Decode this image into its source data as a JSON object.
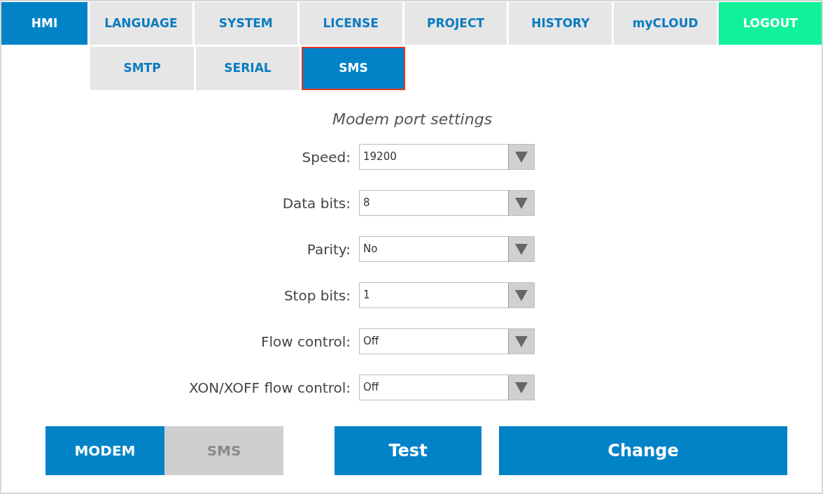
{
  "tabs": [
    {
      "label": "HMI",
      "selected": true,
      "kind": "normal"
    },
    {
      "label": "LANGUAGE",
      "selected": false,
      "kind": "normal"
    },
    {
      "label": "SYSTEM",
      "selected": false,
      "kind": "normal"
    },
    {
      "label": "LICENSE",
      "selected": false,
      "kind": "normal"
    },
    {
      "label": "PROJECT",
      "selected": false,
      "kind": "normal"
    },
    {
      "label": "HISTORY",
      "selected": false,
      "kind": "normal"
    },
    {
      "label": "myCLOUD",
      "selected": false,
      "kind": "normal"
    },
    {
      "label": "LOGOUT",
      "selected": false,
      "kind": "logout"
    }
  ],
  "subtabs": [
    {
      "label": "SMTP",
      "selected": false
    },
    {
      "label": "SERIAL",
      "selected": false
    },
    {
      "label": "SMS",
      "selected": true
    }
  ],
  "section_title": "Modem port settings",
  "fields": [
    {
      "label": "Speed:",
      "value": "19200"
    },
    {
      "label": "Data bits:",
      "value": "8"
    },
    {
      "label": "Parity:",
      "value": "No"
    },
    {
      "label": "Stop bits:",
      "value": "1"
    },
    {
      "label": "Flow control:",
      "value": "Off"
    },
    {
      "label": "XON/XOFF flow control:",
      "value": "Off"
    }
  ],
  "mode_toggle": [
    {
      "label": "MODEM",
      "selected": true
    },
    {
      "label": "SMS",
      "selected": false
    }
  ],
  "actions": [
    "Test",
    "Change"
  ]
}
